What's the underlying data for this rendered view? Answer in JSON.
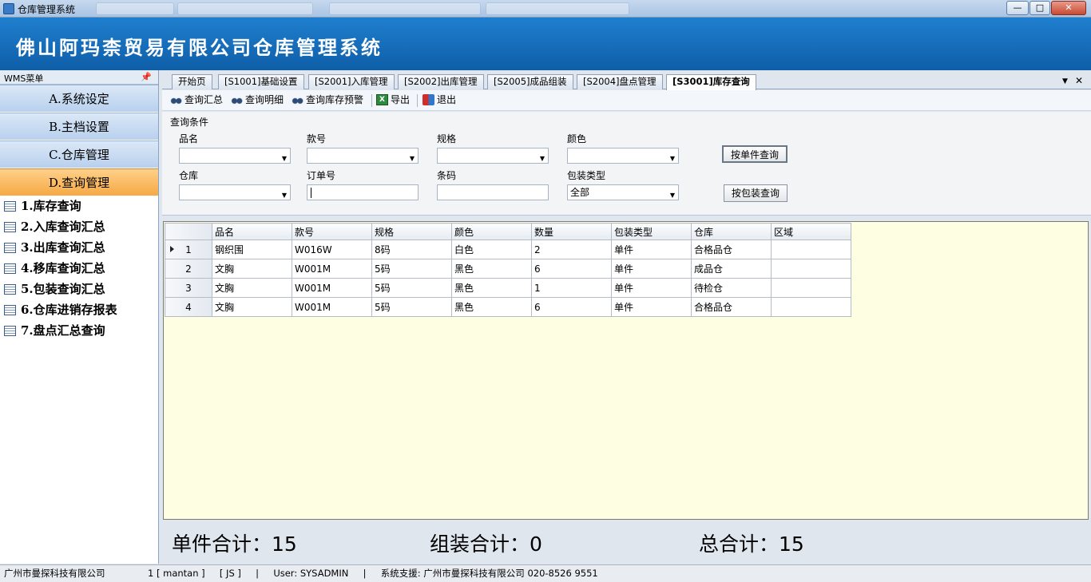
{
  "window": {
    "title": "仓库管理系统",
    "buttons": {
      "minimize": "—",
      "maximize": "□",
      "close": "✕"
    }
  },
  "banner": {
    "system_title": "佛山阿玛柰贸易有限公司仓库管理系统"
  },
  "left_panel": {
    "title": "WMS菜单",
    "groups": [
      {
        "label": "A.系统设定"
      },
      {
        "label": "B.主档设置"
      },
      {
        "label": "C.仓库管理"
      },
      {
        "label": "D.查询管理"
      }
    ],
    "items": [
      {
        "label": "1.库存查询"
      },
      {
        "label": "2.入库查询汇总"
      },
      {
        "label": "3.出库查询汇总"
      },
      {
        "label": "4.移库查询汇总"
      },
      {
        "label": "5.包装查询汇总"
      },
      {
        "label": "6.仓库进销存报表"
      },
      {
        "label": "7.盘点汇总查询"
      }
    ]
  },
  "tabs": [
    {
      "label": "开始页"
    },
    {
      "label": "[S1001]基础设置"
    },
    {
      "label": "[S2001]入库管理"
    },
    {
      "label": "[S2002]出库管理"
    },
    {
      "label": "[S2005]成品组装"
    },
    {
      "label": "[S2004]盘点管理"
    },
    {
      "label": "[S3001]库存查询"
    }
  ],
  "tab_controls": {
    "dropdown": "▼",
    "close": "✕"
  },
  "toolbar": {
    "query_summary": "查询汇总",
    "query_detail": "查询明细",
    "query_stock_alert": "查询库存预警",
    "export": "导出",
    "exit": "退出"
  },
  "query": {
    "caption": "查询条件",
    "labels": {
      "name": "品名",
      "style": "款号",
      "spec": "规格",
      "color": "颜色",
      "warehouse": "仓库",
      "order_no": "订单号",
      "barcode": "条码",
      "pack_type": "包装类型"
    },
    "values": {
      "name": "",
      "style": "",
      "spec": "",
      "color": "",
      "warehouse": "",
      "order_no": "",
      "barcode": "",
      "pack_type": "全部"
    },
    "buttons": {
      "by_single": "按单件查询",
      "by_pack": "按包装查询"
    }
  },
  "grid": {
    "columns": [
      "品名",
      "款号",
      "规格",
      "颜色",
      "数量",
      "包装类型",
      "仓库",
      "区域"
    ],
    "rows": [
      {
        "no": "1",
        "cells": [
          "钢织围",
          "W016W",
          "8码",
          "白色",
          "2",
          "单件",
          "合格品仓",
          ""
        ]
      },
      {
        "no": "2",
        "cells": [
          "文胸",
          "W001M",
          "5码",
          "黑色",
          "6",
          "单件",
          "成品仓",
          ""
        ]
      },
      {
        "no": "3",
        "cells": [
          "文胸",
          "W001M",
          "5码",
          "黑色",
          "1",
          "单件",
          "待检仓",
          ""
        ]
      },
      {
        "no": "4",
        "cells": [
          "文胸",
          "W001M",
          "5码",
          "黑色",
          "6",
          "单件",
          "合格品仓",
          ""
        ]
      }
    ]
  },
  "totals": {
    "single_label": "单件合计：",
    "single_value": "15",
    "assembly_label": "组装合计：",
    "assembly_value": "0",
    "total_label": "总合计：",
    "total_value": "15"
  },
  "status": {
    "company": "广州市曼探科技有限公司",
    "session": "1 [ mantan ]     [ JS ]     |     User: SYSADMIN     |     系统支援: 广州市曼探科技有限公司 020-8526 9551"
  }
}
